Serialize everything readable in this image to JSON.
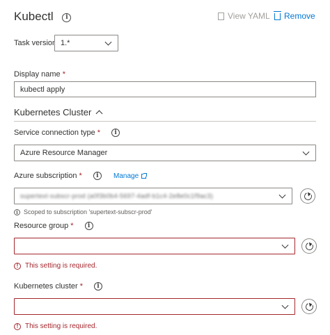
{
  "header": {
    "title": "Kubectl",
    "view_yaml_label": "View YAML",
    "remove_label": "Remove"
  },
  "task_version": {
    "label": "Task version",
    "value": "1.*"
  },
  "display_name": {
    "label": "Display name",
    "required_mark": "*",
    "value": "kubectl apply"
  },
  "section": {
    "title": "Kubernetes Cluster"
  },
  "service_connection_type": {
    "label": "Service connection type",
    "required_mark": "*",
    "value": "Azure Resource Manager"
  },
  "azure_subscription": {
    "label": "Azure subscription",
    "required_mark": "*",
    "manage_label": "Manage",
    "value": "supertext-subscr-prod (a0f3b0b4-5697-4adf-b1c4-2e8e0c1f9ac3)",
    "scope_note": "Scoped to subscription 'supertext-subscr-prod'"
  },
  "resource_group": {
    "label": "Resource group",
    "required_mark": "*",
    "value": "",
    "error": "This setting is required."
  },
  "kubernetes_cluster": {
    "label": "Kubernetes cluster",
    "required_mark": "*",
    "value": "",
    "error": "This setting is required."
  },
  "colors": {
    "accent": "#0078d4",
    "error": "#a4262c",
    "border": "#8a8886"
  }
}
